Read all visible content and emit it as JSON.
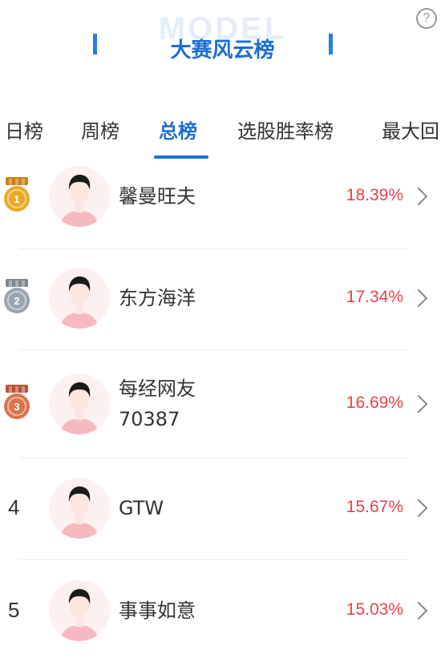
{
  "header": {
    "watermark": "MODEL",
    "title": "大赛风云榜",
    "help": "?"
  },
  "tabs": [
    {
      "label": "日榜"
    },
    {
      "label": "周榜"
    },
    {
      "label": "总榜",
      "active": true
    },
    {
      "label": "选股胜率榜"
    },
    {
      "label": "最大回"
    }
  ],
  "ranking": [
    {
      "rank": "1",
      "medal": "gold",
      "name_lines": [
        "馨曼旺夫"
      ],
      "rate": "18.39%"
    },
    {
      "rank": "2",
      "medal": "silver",
      "name_lines": [
        "东方海洋"
      ],
      "rate": "17.34%"
    },
    {
      "rank": "3",
      "medal": "bronze",
      "name_lines": [
        "每经网友",
        "70387"
      ],
      "rate": "16.69%"
    },
    {
      "rank": "4",
      "medal": "",
      "name_lines": [
        "GTW"
      ],
      "rate": "15.67%"
    },
    {
      "rank": "5",
      "medal": "",
      "name_lines": [
        "事事如意"
      ],
      "rate": "15.03%"
    }
  ],
  "colors": {
    "accent": "#1d6fd2",
    "rate": "#e8414b",
    "gold": "#e8a92a",
    "silver": "#9aa4ae",
    "bronze": "#d9744e"
  },
  "icons": {
    "help": "question-circle-icon",
    "chevron": "chevron-right-icon",
    "medal": "medal-icon",
    "avatar": "user-avatar-icon"
  }
}
